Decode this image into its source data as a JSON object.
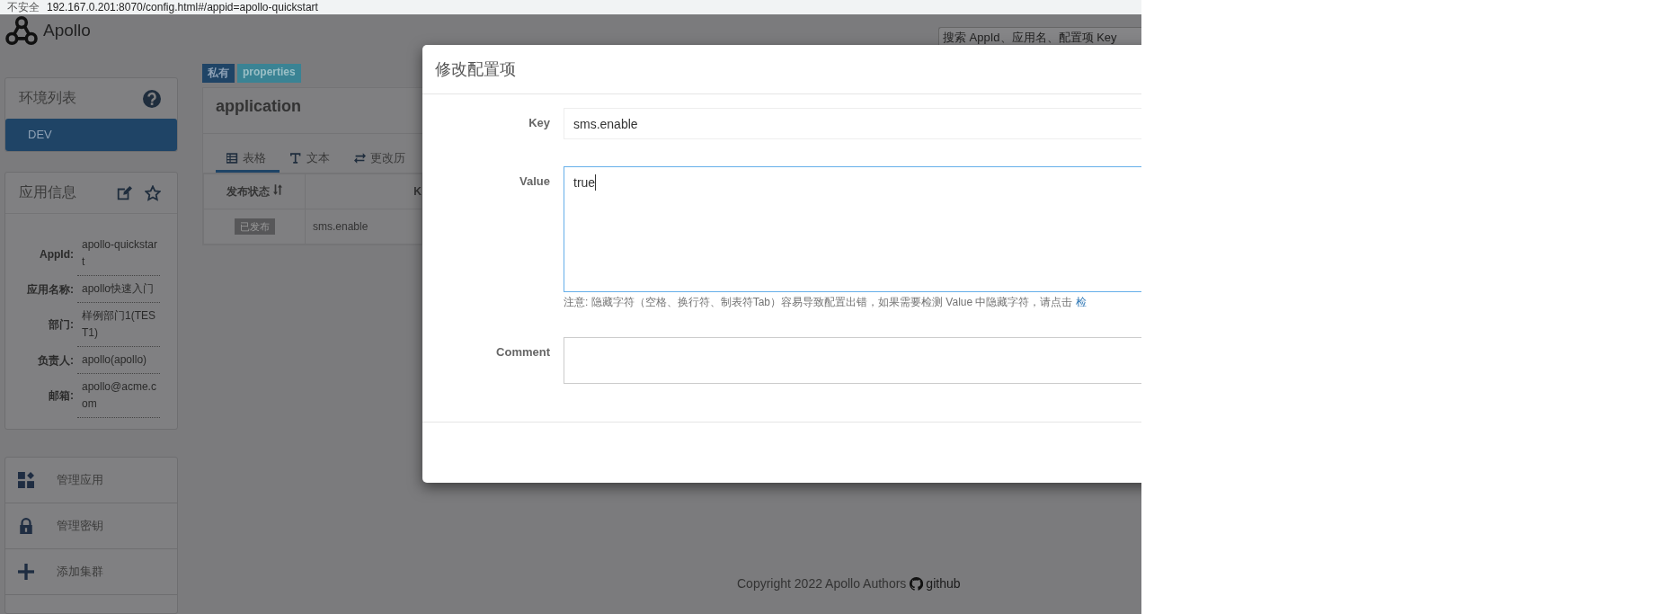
{
  "browser": {
    "security": "不安全",
    "url": "192.167.0.201:8070/config.html#/appid=apollo-quickstart"
  },
  "header": {
    "logo": "Apollo",
    "search": {
      "placeholder": "搜索 AppId、应用名、配置项 Key"
    }
  },
  "env_panel": {
    "title": "环境列表",
    "items": [
      {
        "label": "DEV",
        "selected": true
      }
    ]
  },
  "app_info": {
    "title": "应用信息",
    "fields": [
      {
        "label": "AppId:",
        "value": "apollo-quickstart"
      },
      {
        "label": "应用名称:",
        "value": "apollo快速入门"
      },
      {
        "label": "部门:",
        "value": "样例部门1(TEST1)"
      },
      {
        "label": "负责人:",
        "value": "apollo(apollo)"
      },
      {
        "label": "邮箱:",
        "value": "apollo@acme.com"
      }
    ]
  },
  "menu": [
    {
      "kind": "apps",
      "label": "管理应用"
    },
    {
      "kind": "lock",
      "label": "管理密钥"
    },
    {
      "kind": "add",
      "label": "添加集群"
    }
  ],
  "namespace": {
    "badges": [
      {
        "kind": "scope",
        "label": "私有"
      },
      {
        "kind": "format",
        "label": "properties"
      }
    ],
    "title": "application",
    "tabs": [
      {
        "kind": "table",
        "label": "表格",
        "selected": true
      },
      {
        "kind": "text",
        "label": "文本",
        "selected": false
      },
      {
        "kind": "history",
        "label": "更改历",
        "selected": false
      }
    ],
    "table": {
      "columns": [
        "发布状态",
        "K"
      ],
      "rows": [
        {
          "status": "已发布",
          "key": "sms.enable"
        }
      ]
    }
  },
  "modal": {
    "title": "修改配置项",
    "fields": [
      {
        "kind": "input",
        "label": "Key",
        "value": "sms.enable",
        "focused": false
      },
      {
        "kind": "textarea",
        "label": "Value",
        "value": "true",
        "focused": true,
        "note": "注意: 隐藏字符（空格、换行符、制表符Tab）容易导致配置出错，如果需要检测 Value 中隐藏字符，请点击",
        "note_link": "检"
      },
      {
        "kind": "comment",
        "label": "Comment",
        "focused": false
      }
    ]
  },
  "footer": {
    "copyright": "Copyright 2022 Apollo Authors",
    "link": "github"
  }
}
